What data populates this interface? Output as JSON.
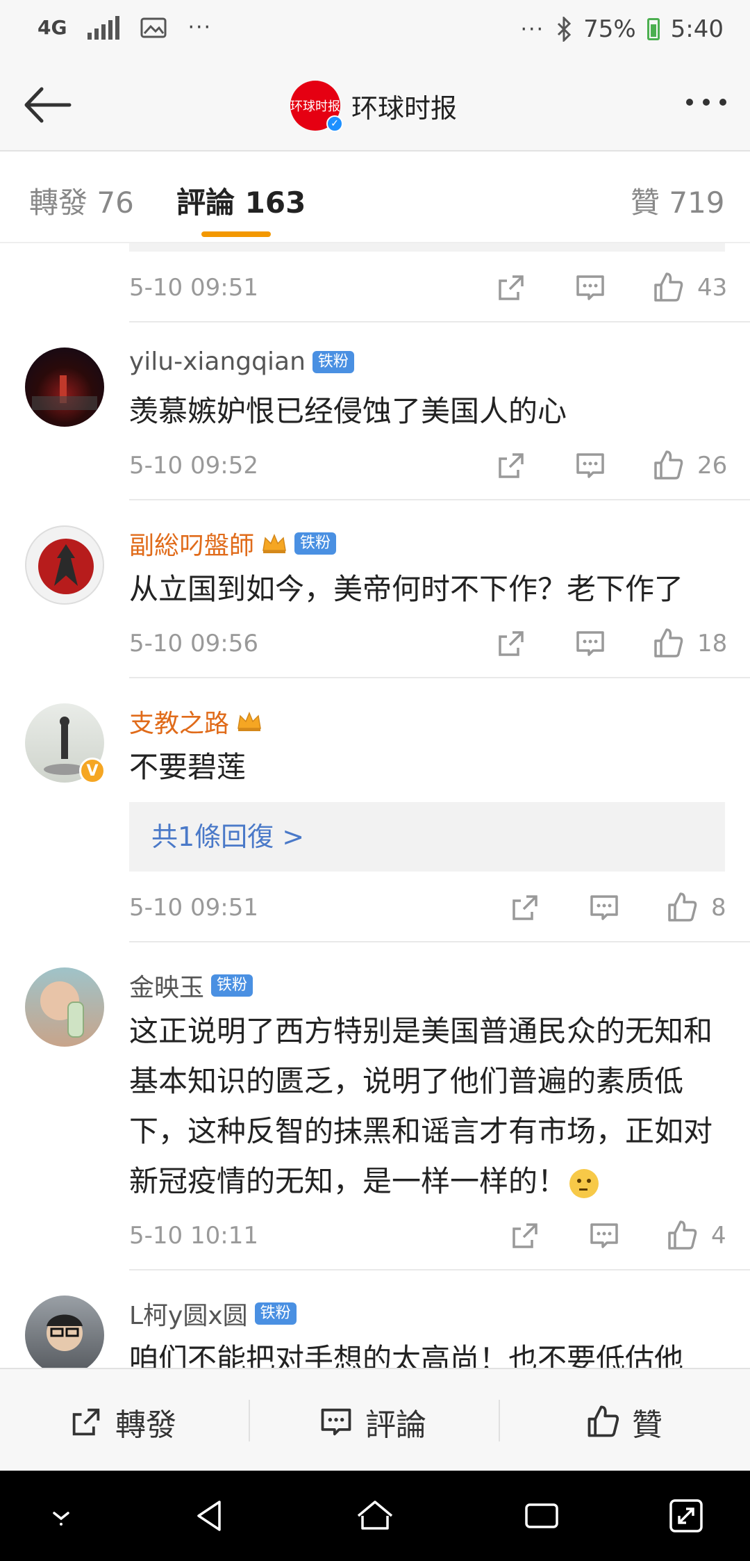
{
  "status_bar": {
    "network": "4G",
    "battery": "75%",
    "time": "5:40",
    "icons": [
      "signal-icon",
      "image-icon",
      "more-dots-icon",
      "bluetooth-icon",
      "battery-icon"
    ]
  },
  "header": {
    "title": "环球时报",
    "avatar_text": "环球时报",
    "verified": true,
    "back_icon": "arrow-left-icon",
    "more_icon": "more-dots-icon"
  },
  "tabs": [
    {
      "label": "轉發 76"
    },
    {
      "label": "評論 163",
      "active": true
    },
    {
      "label": "贊 719"
    }
  ],
  "accent_color": "#f39800",
  "top_meta": {
    "time": "5-10 09:51",
    "likes": "43"
  },
  "comments": [
    {
      "username": "yilu-xiangqian",
      "badge": "铁粉",
      "text": "羡慕嫉妒恨已经侵蚀了美国人的心",
      "time": "5-10 09:52",
      "likes": "26"
    },
    {
      "username": "副総叼盤師",
      "badge": "铁粉",
      "crown": true,
      "text": "从立国到如今，美帝何时不下作？老下作了",
      "time": "5-10 09:56",
      "likes": "18"
    },
    {
      "username": "支教之路",
      "crown": true,
      "verified": true,
      "text": "不要碧莲",
      "reply_label": "共1條回復 >",
      "time": "5-10 09:51",
      "likes": "8"
    },
    {
      "username": "金映玉",
      "badge": "铁粉",
      "text": "这正说明了西方特别是美国普通民众的无知和基本知识的匮乏，说明了他们普遍的素质低下，这种反智的抹黑和谣言才有市场，正如对新冠疫情的无知，是一样一样的！",
      "time": "5-10 10:11",
      "likes": "4"
    },
    {
      "username": "L柯y圆x圆",
      "badge": "铁粉",
      "text": "咱们不能把对手想的太高尚！也不要低估他"
    }
  ],
  "bottom_bar": {
    "repost": "轉發",
    "comment": "評論",
    "like": "贊"
  },
  "nav_bar": {
    "icons": [
      "chevron-down-icon",
      "back-triangle-icon",
      "home-icon",
      "recents-icon",
      "expand-icon"
    ]
  }
}
